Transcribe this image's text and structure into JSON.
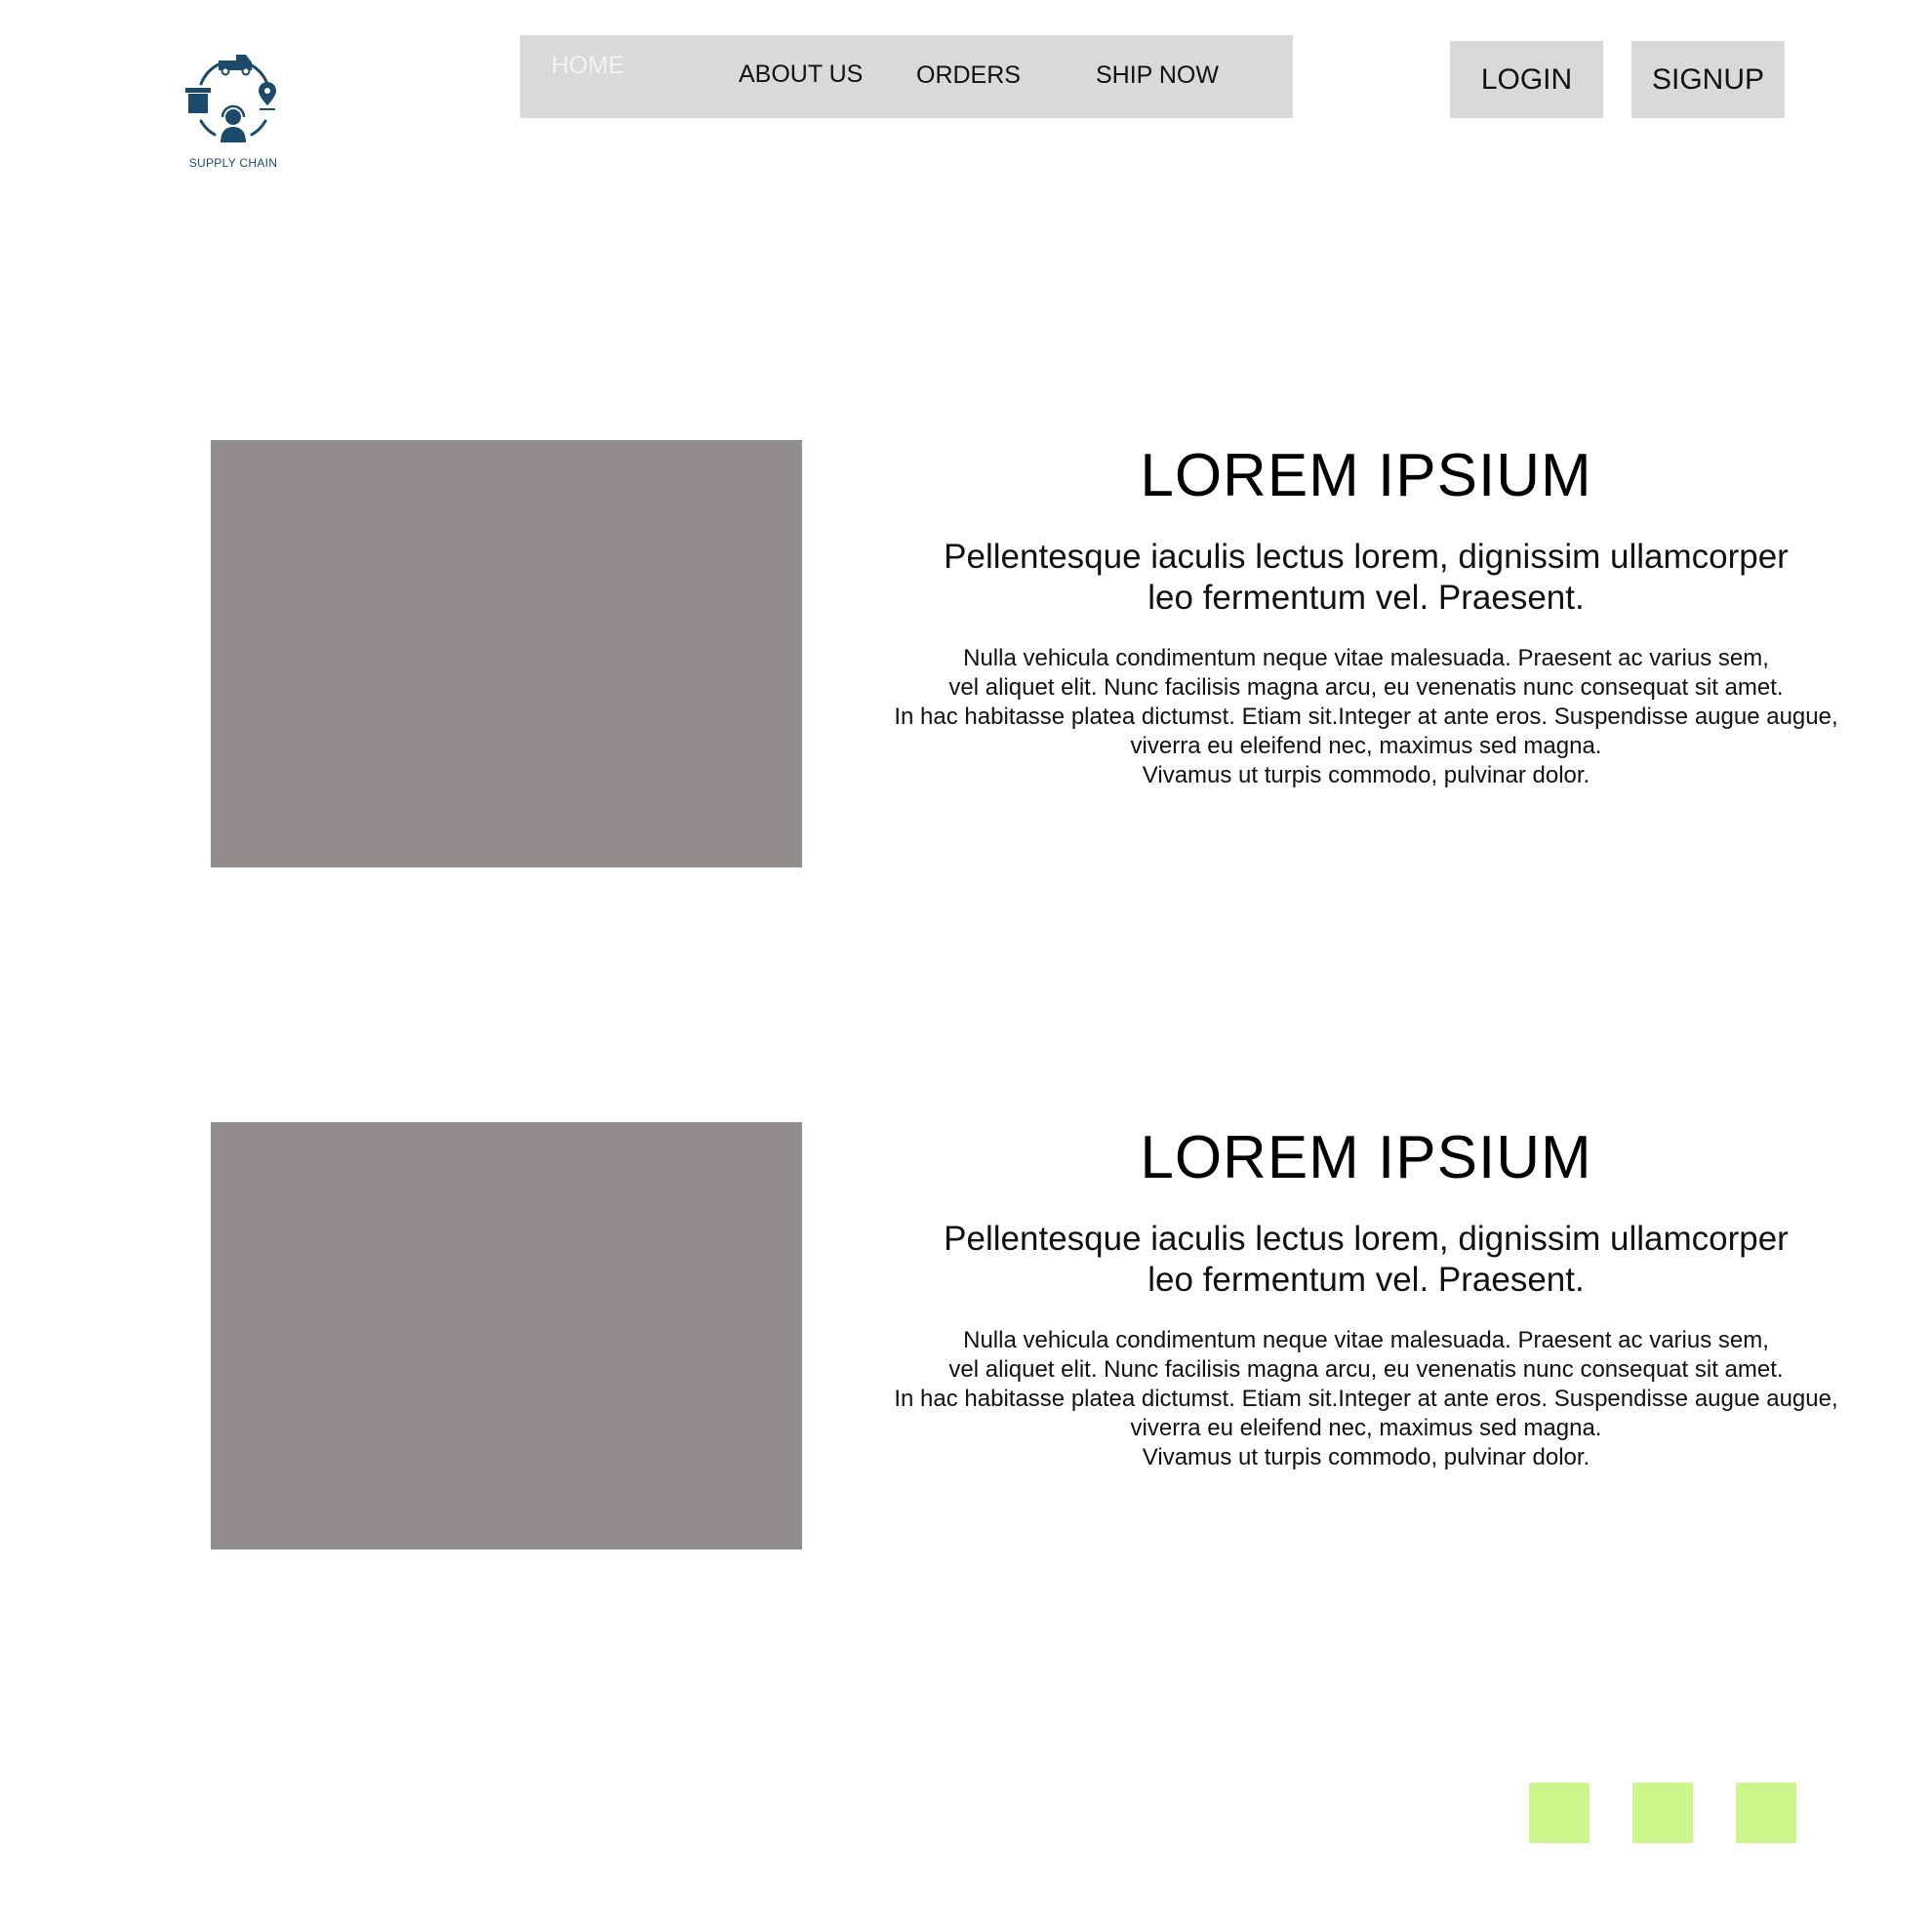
{
  "logo": {
    "text": "SUPPLY CHAIN",
    "icon": "supply-chain-cycle-icon",
    "color": "#1b4a6b"
  },
  "nav": {
    "items": [
      {
        "label": "HOME"
      },
      {
        "label": "ABOUT US"
      },
      {
        "label": "ORDERS"
      },
      {
        "label": "SHIP NOW"
      }
    ]
  },
  "auth": {
    "login_label": "LOGIN",
    "signup_label": "SIGNUP"
  },
  "sections": [
    {
      "title": "LOREM IPSIUM",
      "subtitle_lines": [
        "Pellentesque iaculis lectus lorem, dignissim ullamcorper",
        "leo fermentum vel. Praesent."
      ],
      "body_lines": [
        "Nulla vehicula condimentum neque vitae malesuada. Praesent ac varius sem,",
        "vel aliquet elit. Nunc facilisis magna arcu, eu venenatis nunc consequat sit amet.",
        "In hac habitasse platea dictumst. Etiam sit.Integer at ante eros. Suspendisse augue augue,",
        "viverra eu eleifend nec, maximus sed magna.",
        "Vivamus ut turpis commodo, pulvinar dolor."
      ]
    },
    {
      "title": "LOREM IPSIUM",
      "subtitle_lines": [
        "Pellentesque iaculis lectus lorem, dignissim ullamcorper",
        "leo fermentum vel. Praesent."
      ],
      "body_lines": [
        "Nulla vehicula condimentum neque vitae malesuada. Praesent ac varius sem,",
        "vel aliquet elit. Nunc facilisis magna arcu, eu venenatis nunc consequat sit amet.",
        "In hac habitasse platea dictumst. Etiam sit.Integer at ante eros. Suspendisse augue augue,",
        "viverra eu eleifend nec, maximus sed magna.",
        "Vivamus ut turpis commodo, pulvinar dolor."
      ]
    }
  ],
  "colors": {
    "nav_bg": "#d9d9d9",
    "image_placeholder": "#918e8d",
    "pager_square": "#ccf68a"
  },
  "pager": {
    "count": 3
  }
}
